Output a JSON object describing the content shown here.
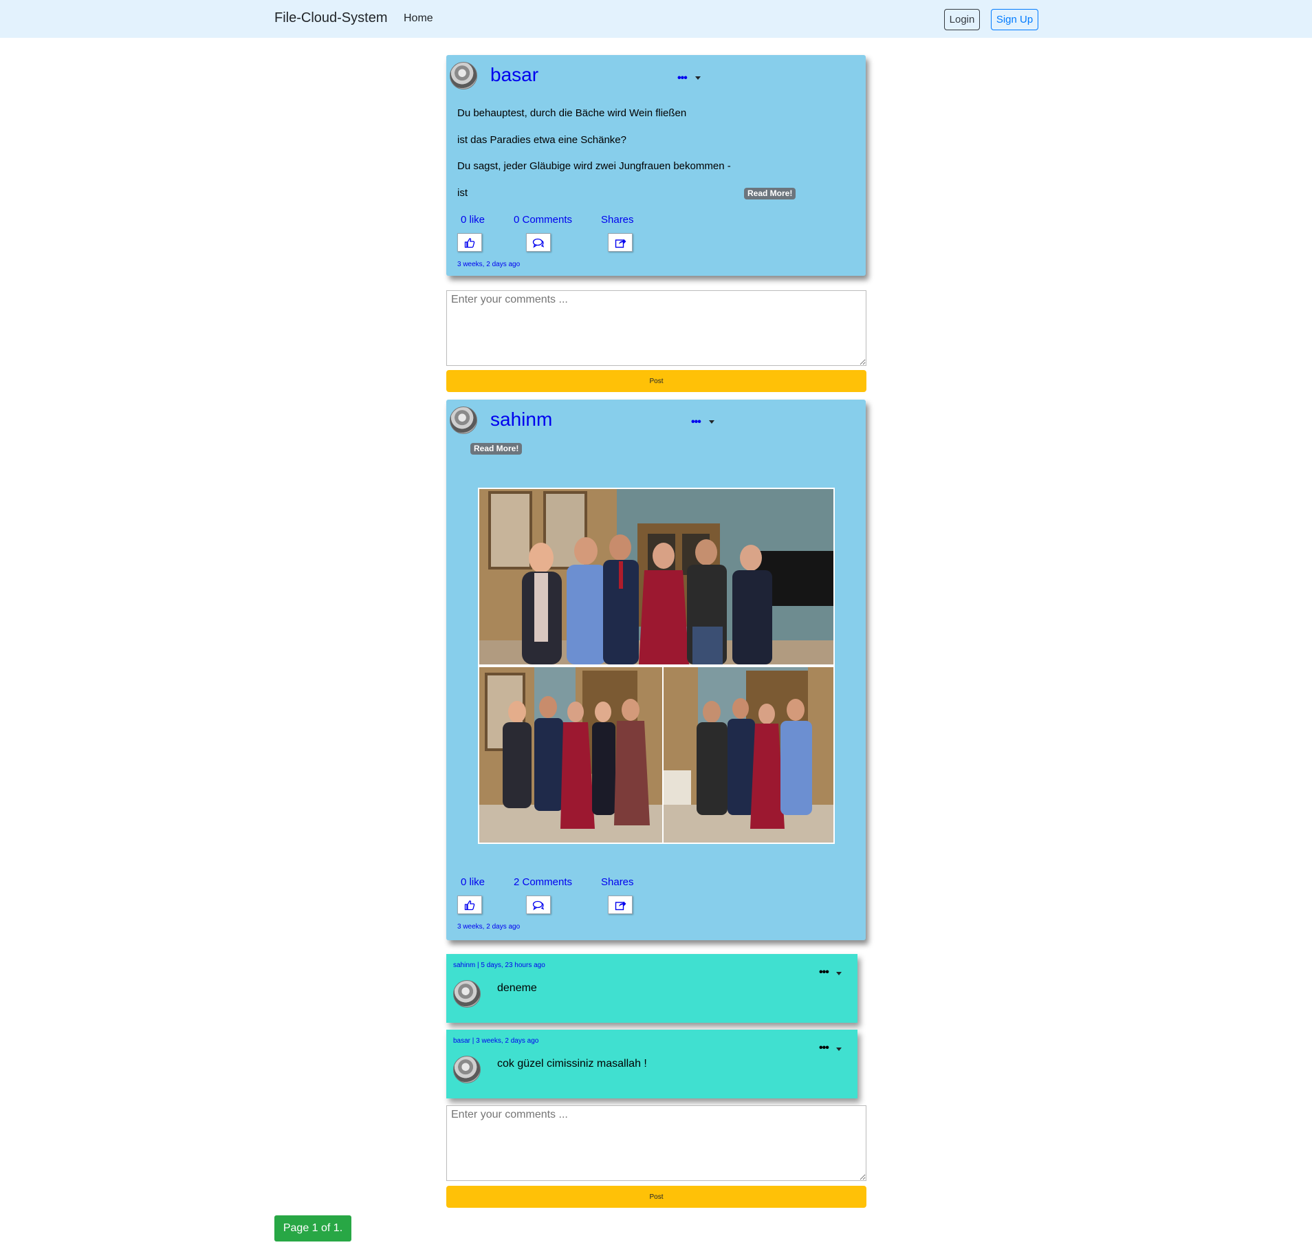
{
  "nav": {
    "brand": "File-Cloud-System",
    "home": "Home",
    "login": "Login",
    "signup": "Sign Up"
  },
  "posts": [
    {
      "user": "basar",
      "menu": "•••",
      "lines": [
        "Du behauptest, durch die Bäche wird Wein fließen",
        "ist das Paradies etwa eine Schänke?",
        "Du sagst, jeder Gläubige wird zwei Jungfrauen bekommen -",
        "ist"
      ],
      "read_more": "Read More!",
      "likes": "0 like",
      "comments": "0 Comments",
      "shares": "Shares",
      "time": "3 weeks, 2 days ago"
    },
    {
      "user": "sahinm",
      "menu": "•••",
      "read_more": "Read More!",
      "likes": "0 like",
      "comments": "2 Comments",
      "shares": "Shares",
      "time": "3 weeks, 2 days ago",
      "replies": [
        {
          "meta": "sahinm | 5 days, 23 hours ago",
          "text": "deneme",
          "menu": "•••"
        },
        {
          "meta": "basar | 3 weeks, 2 days ago",
          "text": "cok güzel cimissiniz masallah !",
          "menu": "•••"
        }
      ]
    }
  ],
  "comment_input": {
    "placeholder": "Enter your comments ..."
  },
  "post_button": "Post",
  "pager": "Page 1 of 1.",
  "colors": {
    "navbar": "#e3f2fd",
    "card": "#87ceeb",
    "reply": "#40e0d0",
    "post_button": "#ffc107",
    "pager": "#28a745",
    "link": "#0000ee"
  }
}
